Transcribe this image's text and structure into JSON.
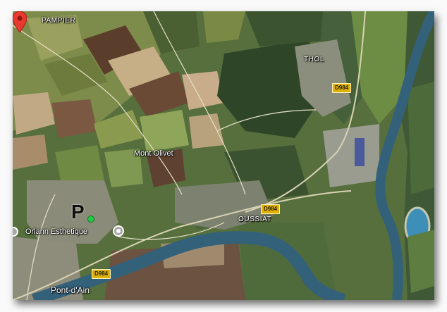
{
  "map": {
    "place_labels": {
      "pampier": "PAMPIER",
      "thol": "THOL",
      "oussiat": "OUSSIAT",
      "pont_dain": "Pont-d'Ain"
    },
    "roads": {
      "d984_a": "D984",
      "d984_b": "D984",
      "d984_c": "D984"
    },
    "markers": {
      "mont_olivet": "Mont Olivet",
      "orlann": "Orlann Esthetique",
      "parking": "P"
    },
    "colors": {
      "pin": "#e8392e",
      "river": "#34617a",
      "road_badge": "#e0b100",
      "field_green": "#6f8a3f",
      "forest": "#33482a"
    }
  }
}
